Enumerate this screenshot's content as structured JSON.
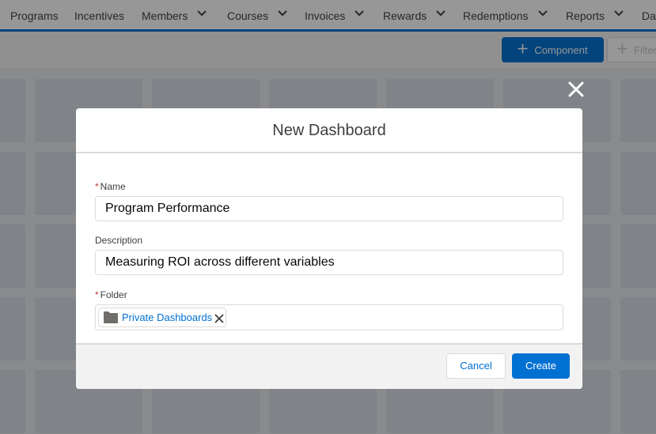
{
  "nav": {
    "items": [
      {
        "label": "Programs",
        "has_menu": false
      },
      {
        "label": "Incentives",
        "has_menu": false
      },
      {
        "label": "Members",
        "has_menu": true
      },
      {
        "label": "Courses",
        "has_menu": true
      },
      {
        "label": "Invoices",
        "has_menu": true
      },
      {
        "label": "Rewards",
        "has_menu": true
      },
      {
        "label": "Redemptions",
        "has_menu": true
      },
      {
        "label": "Reports",
        "has_menu": true
      },
      {
        "label": "Da",
        "has_menu": false
      }
    ],
    "accent_color": "#0070d2"
  },
  "toolbar": {
    "component_label": "Component",
    "component_icon": "plus-icon",
    "filter_label": "Filter",
    "filter_icon": "plus-icon"
  },
  "modal": {
    "title": "New Dashboard",
    "close_icon": "close-icon",
    "name": {
      "label": "Name",
      "required": true,
      "value": "Program Performance"
    },
    "description": {
      "label": "Description",
      "value": "Measuring ROI across different variables"
    },
    "folder": {
      "label": "Folder",
      "required": true,
      "selected": "Private Dashboards",
      "icon": "folder-icon",
      "remove_icon": "close-icon"
    },
    "cancel_label": "Cancel",
    "create_label": "Create"
  },
  "colors": {
    "brand": "#0070d2",
    "required": "#c23934",
    "overlay": "rgba(8,7,7,0.42)"
  }
}
